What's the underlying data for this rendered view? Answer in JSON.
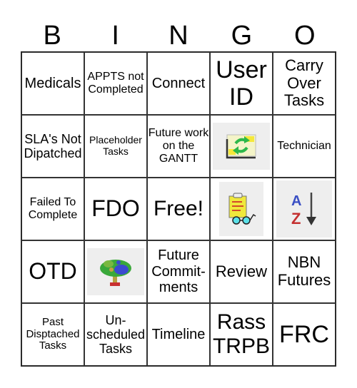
{
  "header": {
    "letters": [
      "B",
      "I",
      "N",
      "G",
      "O"
    ]
  },
  "cells": [
    {
      "text": "Medicals"
    },
    {
      "text": "APPTS not Completed"
    },
    {
      "text": "Connect"
    },
    {
      "text": "User ID"
    },
    {
      "text": "Carry Over Tasks"
    },
    {
      "text": "SLA's Not Dipatched"
    },
    {
      "text": "Placeholder Tasks"
    },
    {
      "text": "Future work on the GANTT"
    },
    {
      "icon": "refresh-document-icon"
    },
    {
      "text": "Technician"
    },
    {
      "text": "Failed To Complete"
    },
    {
      "text": "FDO"
    },
    {
      "text": "Free!"
    },
    {
      "icon": "clipboard-glasses-icon"
    },
    {
      "icon": "sort-a-z-icon"
    },
    {
      "text": "OTD"
    },
    {
      "icon": "tree-icon"
    },
    {
      "text": "Future Commit-ments"
    },
    {
      "text": "Review"
    },
    {
      "text": "NBN Futures"
    },
    {
      "text": "Past Disptached Tasks"
    },
    {
      "text": "Un-scheduled Tasks"
    },
    {
      "text": "Timeline"
    },
    {
      "text": "Rass TRPB"
    },
    {
      "text": "FRC"
    }
  ]
}
